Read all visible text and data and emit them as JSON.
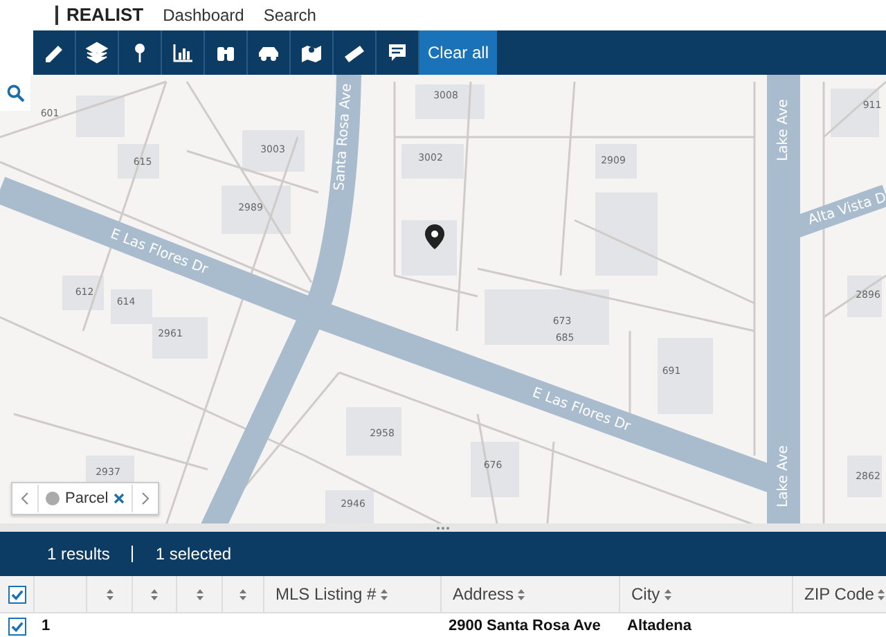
{
  "header": {
    "brand": "REALIST",
    "nav": [
      "Dashboard",
      "Search"
    ]
  },
  "toolbar": {
    "tools": [
      {
        "kind": "pencil"
      },
      {
        "kind": "layers"
      },
      {
        "kind": "pin"
      },
      {
        "kind": "chart"
      },
      {
        "kind": "binoculars"
      },
      {
        "kind": "car"
      },
      {
        "kind": "map"
      },
      {
        "kind": "ruler"
      },
      {
        "kind": "comment"
      }
    ],
    "clear_button": "Clear all"
  },
  "map": {
    "streets": [
      {
        "name": "E Las Flores Dr"
      },
      {
        "name": "E Las Flores Dr"
      },
      {
        "name": "Santa Rosa Ave"
      },
      {
        "name": "Lake Ave"
      },
      {
        "name": "Lake Ave"
      },
      {
        "name": "Alta Vista D"
      }
    ],
    "parcel_numbers": [
      "601",
      "615",
      "3003",
      "2989",
      "3008",
      "3002",
      "2909",
      "911",
      "612",
      "614",
      "2961",
      "673",
      "685",
      "691",
      "2896",
      "2958",
      "676",
      "2946",
      "2937",
      "2862"
    ],
    "layer_chip": {
      "label": "Parcel"
    }
  },
  "results": {
    "count": "1 results",
    "selected": "1 selected"
  },
  "table": {
    "all_checked": true,
    "columns": [
      {
        "sortable": false
      },
      {
        "sortable": true
      },
      {
        "sortable": true
      },
      {
        "sortable": true
      },
      {
        "sortable": true
      },
      {
        "label": "MLS Listing #",
        "sortable": true
      },
      {
        "label": "Address",
        "sortable": true
      },
      {
        "label": "City",
        "sortable": true
      },
      {
        "label": "ZIP Code",
        "sortable": true
      }
    ],
    "rows": [
      {
        "checked": true,
        "number": "1",
        "address": "2900 Santa Rosa Ave",
        "city": "Altadena"
      }
    ]
  }
}
